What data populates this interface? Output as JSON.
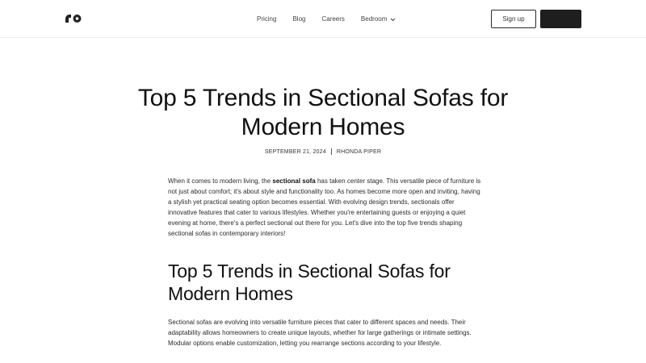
{
  "nav": {
    "links": [
      "Pricing",
      "Blog",
      "Careers"
    ],
    "dropdown_label": "Bedroom",
    "signup_label": "Sign up"
  },
  "article": {
    "title": "Top 5 Trends in Sectional Sofas for Modern Homes",
    "date": "SEPTEMBER 21, 2024",
    "author": "RHONDA PIPER",
    "intro_before": "When it comes to modern living, the ",
    "intro_bold": "sectional sofa",
    "intro_after": " has taken center stage. This versatile piece of furniture is not just about comfort; it's about style and functionality too. As homes become more open and inviting, having a stylish yet practical seating option becomes essential. With evolving design trends, sectionals offer innovative features that cater to various lifestyles. Whether you're entertaining guests or enjoying a quiet evening at home, there's a perfect sectional out there for you. Let's dive into the top five trends shaping sectional sofas in contemporary interiors!",
    "section_heading": "Top 5 Trends in Sectional Sofas for Modern Homes",
    "section_body": "Sectional sofas are evolving into versatile furniture pieces that cater to different spaces and needs. Their adaptability allows homeowners to create unique layouts, whether for large gatherings or intimate settings. Modular options enable customization, letting you rearrange sections according to your lifestyle."
  },
  "colors": {
    "text": "#1a1a1a",
    "dark_button": "#1e1e1e",
    "border": "#ececec"
  }
}
